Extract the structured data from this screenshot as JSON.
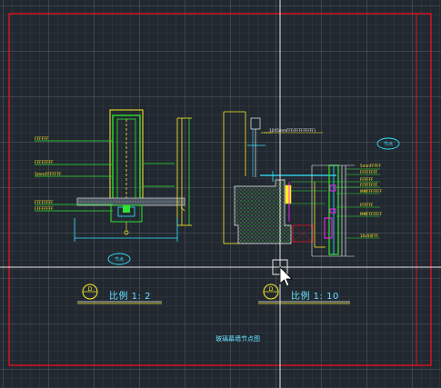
{
  "drawing": {
    "left_detail": {
      "scale_label": "比例  1: 2",
      "index_tag": "节点",
      "marker_letter": "D",
      "note_labels": [
        "FFFFFF",
        "FFFFFFFF",
        "5mmFFFFFFF",
        "FFFFFFFF",
        "FFFFFFFF"
      ]
    },
    "right_detail": {
      "scale_label": "比例  1: 10",
      "index_tag": "节点",
      "marker_letter": "D",
      "top_note": "10X5mmFFF(FFFFFFFFF)",
      "note_labels": [
        "5mmFFFFF",
        "FFFFFFFF",
        "FFFFFF",
        "FFFFFFFF",
        "MMFFFFFFF",
        "FFFFFF",
        "MMFFFFFFF",
        "10x50FFF"
      ]
    },
    "sheet_title": "玻璃幕墙节点图"
  },
  "colors": {
    "frame": "#e0121e",
    "crosshair": "#e8e8e8",
    "cyan": "#33e6ff",
    "green": "#2ee62e",
    "yellow": "#ffee22",
    "magenta": "#ff22ff",
    "white": "#f0f0f0"
  },
  "icons": {
    "cursor": "arrow-cursor-icon",
    "crosshair": "crosshair-icon"
  }
}
